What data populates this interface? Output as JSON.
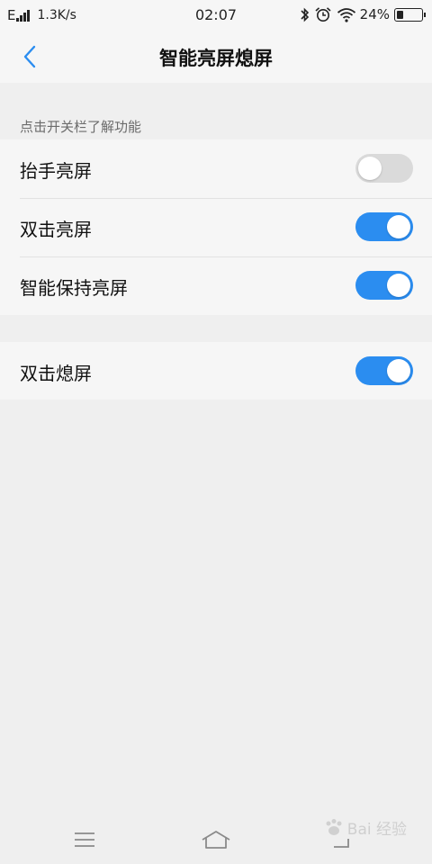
{
  "status_bar": {
    "network_type": "E",
    "speed": "1.3K/s",
    "time": "02:07",
    "battery_percent": "24%",
    "battery_level": 0.24,
    "icons": [
      "signal-icon",
      "bluetooth-icon",
      "alarm-icon",
      "wifi-icon",
      "battery-icon"
    ]
  },
  "header": {
    "title": "智能亮屏熄屏",
    "back_icon": "chevron-left-icon"
  },
  "section": {
    "hint": "点击开关栏了解功能"
  },
  "settings": [
    {
      "label": "抬手亮屏",
      "enabled": false
    },
    {
      "label": "双击亮屏",
      "enabled": true
    },
    {
      "label": "智能保持亮屏",
      "enabled": true
    }
  ],
  "settings_2": [
    {
      "label": "双击熄屏",
      "enabled": true
    }
  ],
  "nav_bar": {
    "icons": [
      "menu-icon",
      "home-icon",
      "back-icon"
    ]
  },
  "watermark": {
    "text": "Bai 经验"
  },
  "colors": {
    "accent": "#2b8df0",
    "toggle_off": "#dadada",
    "background": "#efefef",
    "surface": "#f6f6f6"
  }
}
